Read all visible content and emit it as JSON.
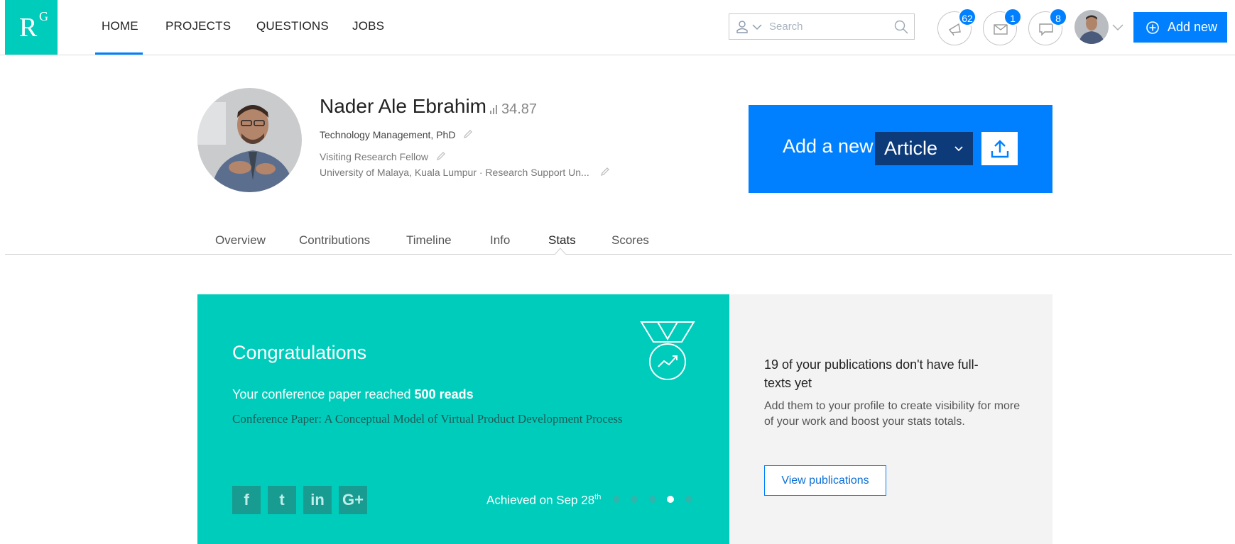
{
  "logo": {
    "letter": "R",
    "superscript": "G"
  },
  "nav": {
    "items": [
      {
        "label": "HOME"
      },
      {
        "label": "PROJECTS"
      },
      {
        "label": "QUESTIONS"
      },
      {
        "label": "JOBS"
      }
    ],
    "active": "HOME"
  },
  "search": {
    "placeholder": "Search",
    "value": ""
  },
  "notifications": {
    "alerts": "62",
    "messages": "1",
    "questions": "8"
  },
  "add_new_label": "Add new",
  "profile": {
    "name": "Nader Ale Ebrahim",
    "score": "34.87",
    "degree": "Technology Management, PhD",
    "position": "Visiting Research Fellow",
    "institution": "University of Malaya, Kuala Lumpur · Research Support Un..."
  },
  "add_article": {
    "label": "Add a new",
    "type": "Article"
  },
  "tabs": [
    {
      "label": "Overview"
    },
    {
      "label": "Contributions"
    },
    {
      "label": "Timeline"
    },
    {
      "label": "Info"
    },
    {
      "label": "Stats"
    },
    {
      "label": "Scores"
    }
  ],
  "active_tab": "Stats",
  "achievement": {
    "title": "Congratulations",
    "reached_prefix": "Your conference paper reached",
    "reached_value": "500 reads",
    "paper": "Conference Paper: A Conceptual Model of Virtual Product Development Process",
    "achieved_text": "Achieved on Sep 28",
    "achieved_suffix": "th",
    "social": [
      {
        "name": "facebook",
        "glyph": "f"
      },
      {
        "name": "twitter",
        "glyph": "t"
      },
      {
        "name": "linkedin",
        "glyph": "in"
      },
      {
        "name": "google-plus",
        "glyph": "G+"
      }
    ],
    "dots_total": 5,
    "active_dot": 4
  },
  "fulltext_prompt": {
    "title": "19 of your publications don't have full-texts yet",
    "body": "Add them to your profile to create visibility for more of your work and boost your stats totals.",
    "button": "View publications"
  },
  "colors": {
    "accent": "#0080ff",
    "teal": "#00ccbb",
    "dark_blue": "#0d3b7a"
  }
}
